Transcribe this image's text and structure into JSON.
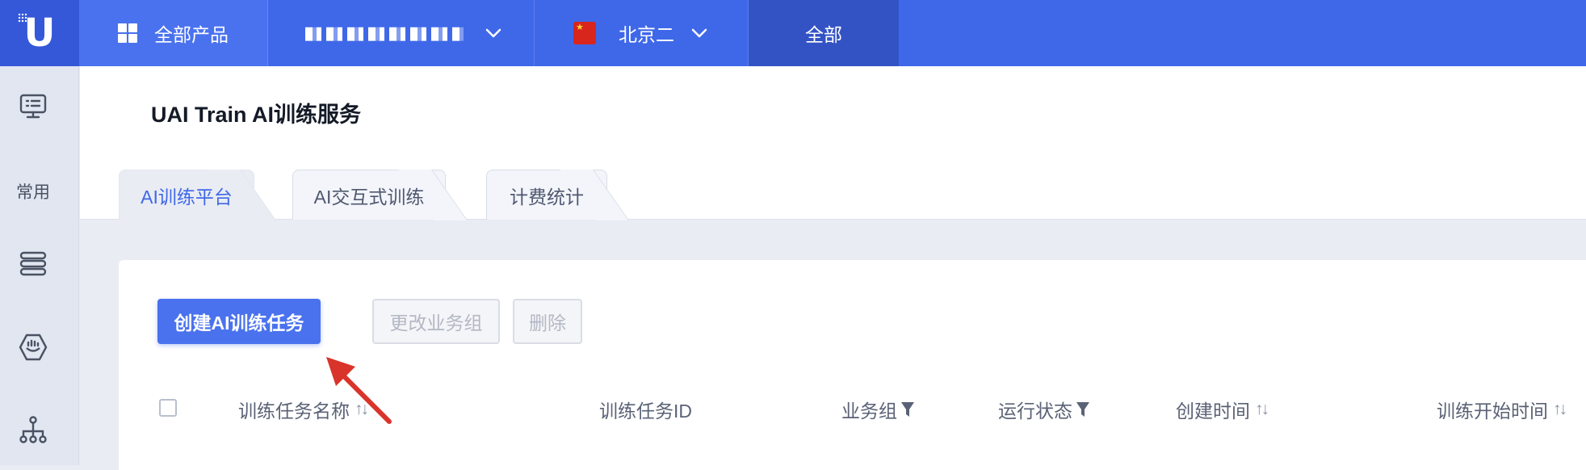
{
  "topbar": {
    "logo_letter": "U",
    "products_label": "全部产品",
    "project_label": "",
    "region_label": "北京二",
    "scope_label": "全部"
  },
  "sidebar": {
    "items": [
      {
        "icon": "monitor-list-icon"
      },
      {
        "label": "常用"
      },
      {
        "icon": "stack-icon"
      },
      {
        "icon": "hexagon-logo-icon"
      },
      {
        "icon": "org-tree-icon"
      }
    ]
  },
  "page": {
    "title": "UAI Train AI训练服务",
    "tabs": [
      {
        "label": "AI训练平台",
        "active": true
      },
      {
        "label": "AI交互式训练",
        "active": false
      },
      {
        "label": "计费统计",
        "active": false
      }
    ]
  },
  "toolbar": {
    "create_label": "创建AI训练任务",
    "change_group_label": "更改业务组",
    "delete_label": "删除"
  },
  "table": {
    "columns": [
      {
        "label": "训练任务名称",
        "control": "sort"
      },
      {
        "label": "训练任务ID",
        "control": "none"
      },
      {
        "label": "业务组",
        "control": "filter"
      },
      {
        "label": "运行状态",
        "control": "filter"
      },
      {
        "label": "创建时间",
        "control": "sort"
      },
      {
        "label": "训练开始时间",
        "control": "sort"
      }
    ]
  },
  "colors": {
    "brand": "#3f68e9",
    "arrow": "#d9342b"
  }
}
